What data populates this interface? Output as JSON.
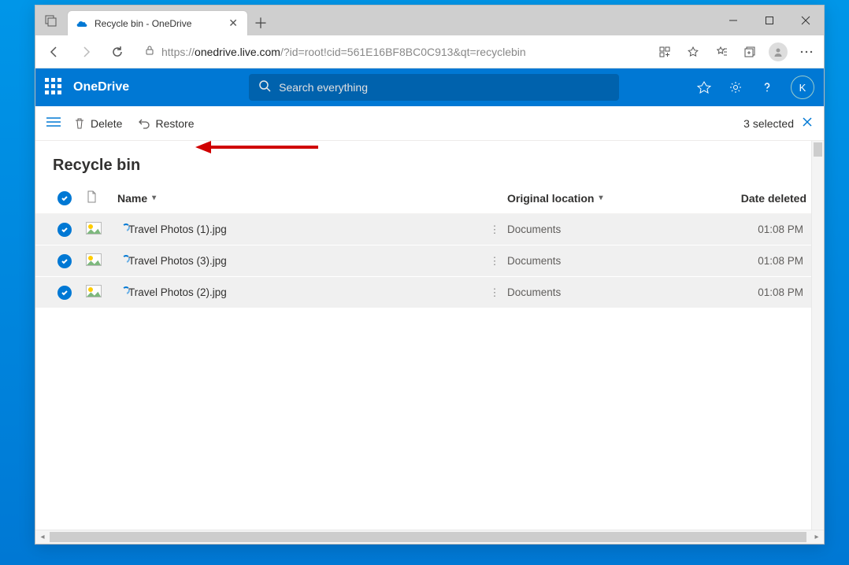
{
  "browser": {
    "tab_title": "Recycle bin - OneDrive",
    "url_prefix": "https://",
    "url_host": "onedrive.live.com",
    "url_path": "/?id=root!cid=561E16BF8BC0C913&qt=recyclebin"
  },
  "header": {
    "app_name": "OneDrive",
    "search_placeholder": "Search everything",
    "user_initial": "K"
  },
  "commands": {
    "delete": "Delete",
    "restore": "Restore",
    "selected": "3 selected"
  },
  "page": {
    "title": "Recycle bin",
    "columns": {
      "name": "Name",
      "location": "Original location",
      "date": "Date deleted"
    },
    "rows": [
      {
        "name": "Travel Photos (1).jpg",
        "location": "Documents",
        "date": "01:08 PM"
      },
      {
        "name": "Travel Photos (3).jpg",
        "location": "Documents",
        "date": "01:08 PM"
      },
      {
        "name": "Travel Photos (2).jpg",
        "location": "Documents",
        "date": "01:08 PM"
      }
    ]
  }
}
